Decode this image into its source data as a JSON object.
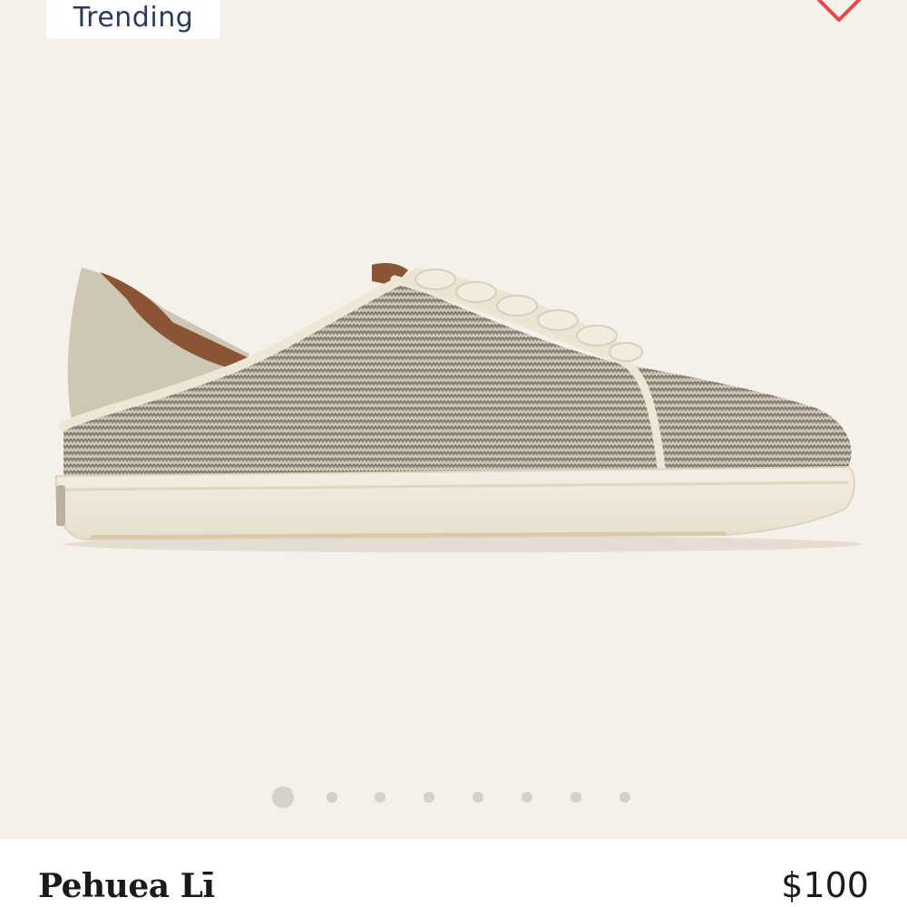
{
  "badge": {
    "label": "Trending"
  },
  "favorite": {
    "icon": "heart-icon",
    "color": "#e5484d"
  },
  "product": {
    "name": "Pehuea Lī",
    "price": "$100",
    "image_icon": "sneaker-image"
  },
  "carousel": {
    "total_slides": 8,
    "active_index": 0
  },
  "colors": {
    "background": "#f5f1ea",
    "text": "#1a1a1a",
    "badge_text": "#2c3a5a",
    "dot_inactive": "#d6d1c8"
  }
}
